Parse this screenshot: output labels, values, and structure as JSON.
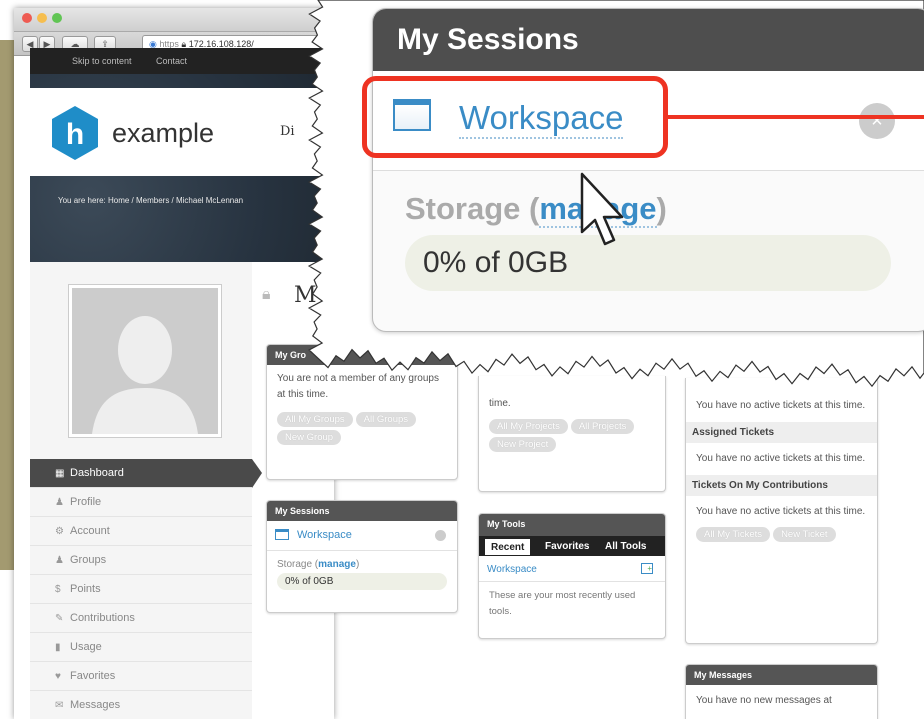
{
  "browser": {
    "url": "https",
    "address": "172.16.108.128/"
  },
  "site": {
    "skip_link": "Skip to content",
    "contact_link": "Contact",
    "logo_letter": "h",
    "logo_text": "example",
    "nav_fragment": "Di",
    "breadcrumb": "You are here: Home / Members / Michael McLennan"
  },
  "sidebar": {
    "items": [
      {
        "icon": "dashboard-icon",
        "glyph": "▦",
        "label": "Dashboard"
      },
      {
        "icon": "profile-icon",
        "glyph": "♟",
        "label": "Profile"
      },
      {
        "icon": "account-icon",
        "glyph": "⚙",
        "label": "Account"
      },
      {
        "icon": "groups-icon",
        "glyph": "♟",
        "label": "Groups"
      },
      {
        "icon": "points-icon",
        "glyph": "$",
        "label": "Points"
      },
      {
        "icon": "contributions-icon",
        "glyph": "✎",
        "label": "Contributions"
      },
      {
        "icon": "usage-icon",
        "glyph": "▮",
        "label": "Usage"
      },
      {
        "icon": "favorites-icon",
        "glyph": "♥",
        "label": "Favorites"
      },
      {
        "icon": "messages-icon",
        "glyph": "✉",
        "label": "Messages"
      }
    ]
  },
  "page_title_fragment": "M",
  "groups": {
    "title": "My Gro",
    "text": "You are not a member of any groups at this time.",
    "buttons": [
      "All My Groups",
      "All Groups",
      "New Group"
    ]
  },
  "projects": {
    "text_frag": "You have no projects at this time.",
    "buttons": [
      "All My Projects",
      "All Projects",
      "New Project"
    ]
  },
  "sessions": {
    "title": "My Sessions",
    "session_label": "Workspace",
    "storage_label": "Storage",
    "manage_label": "manage",
    "storage_value": "0% of 0GB"
  },
  "tools": {
    "title": "My Tools",
    "tabs": [
      "Recent",
      "Favorites",
      "All Tools"
    ],
    "item": "Workspace",
    "note": "These are your most recently used tools."
  },
  "tickets": {
    "intro": "You have no active tickets at this time.",
    "assigned_title": "Assigned Tickets",
    "assigned_text": "You have no active tickets at this time.",
    "contrib_title": "Tickets On My Contributions",
    "contrib_text": "You have no active tickets at this time.",
    "buttons": [
      "All My Tickets",
      "New Ticket"
    ]
  },
  "messages": {
    "title": "My Messages",
    "text": "You have no new messages at"
  },
  "zoom": {
    "title": "My Sessions",
    "session_label": "Workspace",
    "close_glyph": "×",
    "storage_label": "Storage",
    "manage_label": "manage",
    "storage_value": "0% of 0GB",
    "highlight_color": "#ee3322"
  }
}
